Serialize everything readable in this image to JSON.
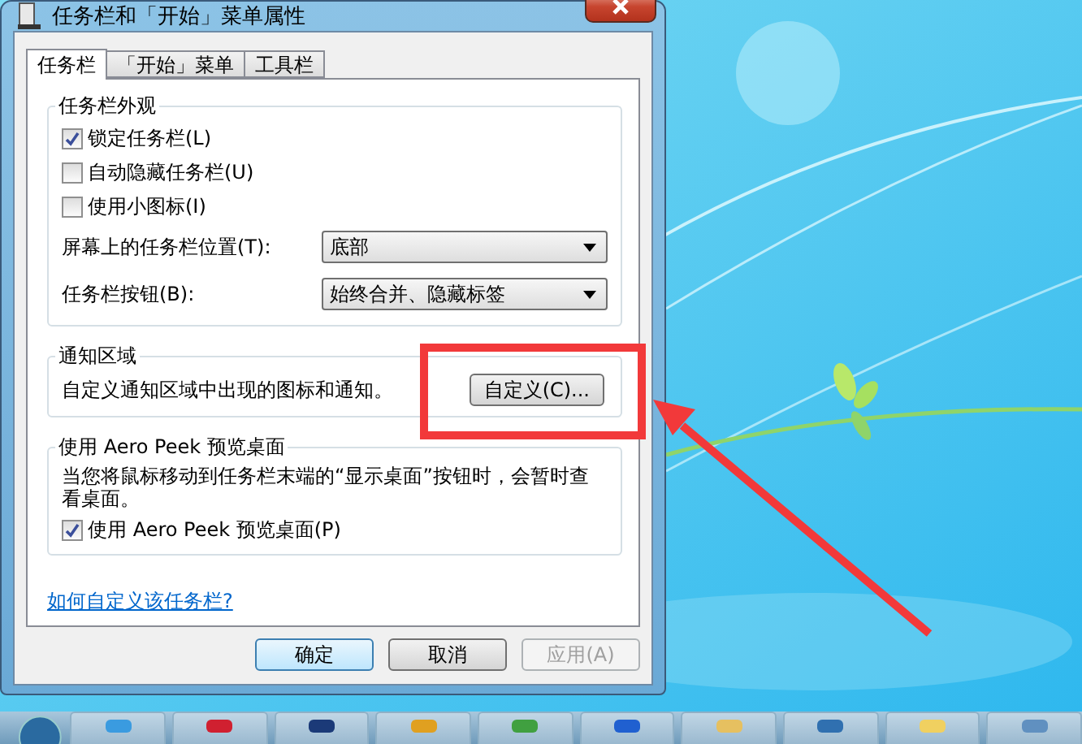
{
  "window": {
    "title": "任务栏和「开始」菜单属性"
  },
  "tabs": [
    {
      "label": "任务栏",
      "selected": true
    },
    {
      "label": "「开始」菜单",
      "selected": false
    },
    {
      "label": "工具栏",
      "selected": false
    }
  ],
  "appearance": {
    "title": "任务栏外观",
    "checkboxes": [
      {
        "label": "锁定任务栏(L)",
        "checked": true
      },
      {
        "label": "自动隐藏任务栏(U)",
        "checked": false
      },
      {
        "label": "使用小图标(I)",
        "checked": false
      }
    ],
    "selects": [
      {
        "label": "屏幕上的任务栏位置(T):",
        "value": "底部"
      },
      {
        "label": "任务栏按钮(B):",
        "value": "始终合并、隐藏标签"
      }
    ]
  },
  "notification": {
    "title": "通知区域",
    "text": "自定义通知区域中出现的图标和通知。",
    "button": "自定义(C)..."
  },
  "aero_peek": {
    "title": "使用 Aero Peek 预览桌面",
    "text": "当您将鼠标移动到任务栏末端的“显示桌面”按钮时，会暂时查看桌面。",
    "checkbox": {
      "label": "使用 Aero Peek 预览桌面(P)",
      "checked": true
    }
  },
  "link": "如何自定义该任务栏?",
  "buttons": [
    {
      "label": "确定",
      "default": true,
      "disabled": false
    },
    {
      "label": "取消",
      "default": false,
      "disabled": false
    },
    {
      "label": "应用(A)",
      "default": false,
      "disabled": true
    }
  ]
}
